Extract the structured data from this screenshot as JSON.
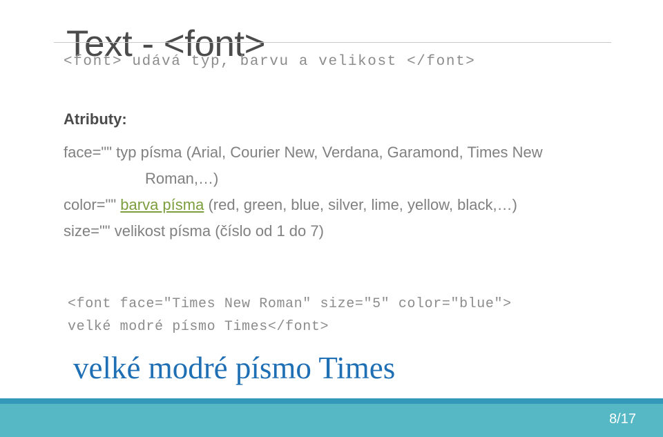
{
  "slide": {
    "title": "Text - <font>",
    "subtitle": "<font> udává typ, barvu a velikost </font>",
    "attributes_heading": "Atributy:",
    "attributes": [
      {
        "name": "face=\"\"",
        "description": " typ písma (Arial, Courier New, Verdana, Garamond, Times New",
        "continuation": "Roman,…)"
      },
      {
        "name": "color=\"\"",
        "link": "barva písma",
        "description": " (red, green, blue, silver, lime, yellow, black,…)"
      },
      {
        "name": "size=\"\"",
        "description": " velikost písma (číslo od 1 do 7)"
      }
    ],
    "code_sample": {
      "line1": "<font face=\"Times New Roman\" size=\"5\" color=\"blue\">",
      "line2": "velké modré písmo Times</font>"
    },
    "result_text": "velké modré písmo Times",
    "footer": {
      "page_number": "8/17"
    }
  },
  "colors": {
    "title": "#4b4b4b",
    "body_text": "#808080",
    "link_green": "#7d9e3e",
    "result_blue": "#1f6fb4",
    "footer_band": "#55b8c4",
    "footer_stripe": "#3498b8",
    "rule": "#c9c9c9"
  }
}
